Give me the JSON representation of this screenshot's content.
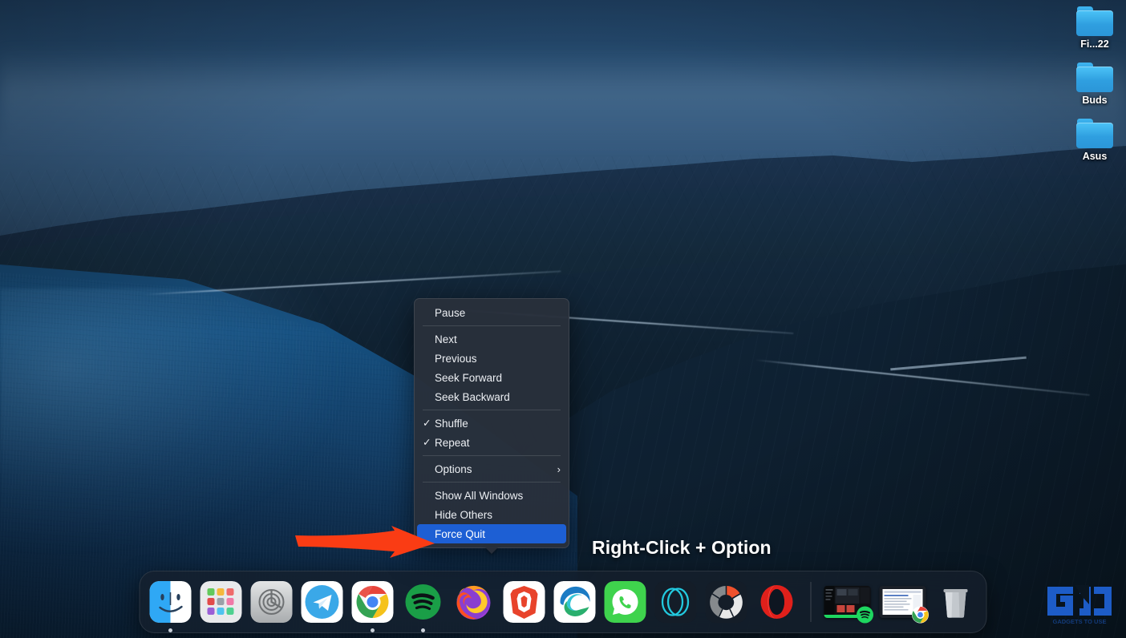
{
  "desktop": {
    "icons": [
      {
        "name": "folder-icon",
        "label": "Fi...22"
      },
      {
        "name": "folder-icon",
        "label": "Buds"
      },
      {
        "name": "folder-icon",
        "label": "Asus"
      }
    ]
  },
  "context_menu": {
    "groups": [
      {
        "items": [
          {
            "label": "Pause",
            "checked": false,
            "submenu": false,
            "highlighted": false
          }
        ]
      },
      {
        "items": [
          {
            "label": "Next",
            "checked": false,
            "submenu": false,
            "highlighted": false
          },
          {
            "label": "Previous",
            "checked": false,
            "submenu": false,
            "highlighted": false
          },
          {
            "label": "Seek Forward",
            "checked": false,
            "submenu": false,
            "highlighted": false
          },
          {
            "label": "Seek Backward",
            "checked": false,
            "submenu": false,
            "highlighted": false
          }
        ]
      },
      {
        "items": [
          {
            "label": "Shuffle",
            "checked": true,
            "submenu": false,
            "highlighted": false
          },
          {
            "label": "Repeat",
            "checked": true,
            "submenu": false,
            "highlighted": false
          }
        ]
      },
      {
        "items": [
          {
            "label": "Options",
            "checked": false,
            "submenu": true,
            "highlighted": false
          }
        ]
      },
      {
        "items": [
          {
            "label": "Show All Windows",
            "checked": false,
            "submenu": false,
            "highlighted": false
          },
          {
            "label": "Hide Others",
            "checked": false,
            "submenu": false,
            "highlighted": false
          },
          {
            "label": "Force Quit",
            "checked": false,
            "submenu": false,
            "highlighted": true
          }
        ]
      }
    ],
    "check_glyph": "✓",
    "submenu_glyph": "›",
    "highlight_color": "#1d5fd4"
  },
  "annotation": {
    "callout_text": "Right-Click + Option",
    "arrow_color": "#FA3C14",
    "arrow_name": "red-arrow-pointer"
  },
  "dock": {
    "apps": [
      {
        "name": "finder-icon",
        "label": "Finder",
        "running": true
      },
      {
        "name": "launchpad-icon",
        "label": "Launchpad",
        "running": false
      },
      {
        "name": "system-preferences-icon",
        "label": "System Preferences",
        "running": false
      },
      {
        "name": "telegram-icon",
        "label": "Telegram",
        "running": false
      },
      {
        "name": "chrome-icon",
        "label": "Google Chrome",
        "running": true
      },
      {
        "name": "spotify-icon",
        "label": "Spotify",
        "running": true
      },
      {
        "name": "firefox-icon",
        "label": "Firefox",
        "running": false
      },
      {
        "name": "brave-icon",
        "label": "Brave",
        "running": false
      },
      {
        "name": "edge-icon",
        "label": "Microsoft Edge",
        "running": false
      },
      {
        "name": "whatsapp-icon",
        "label": "WhatsApp",
        "running": false
      },
      {
        "name": "orion-icon",
        "label": "Orion",
        "running": false
      },
      {
        "name": "vivaldi-icon",
        "label": "Vivaldi",
        "running": false
      },
      {
        "name": "opera-icon",
        "label": "Opera",
        "running": false
      }
    ],
    "minimized": [
      {
        "name": "minimized-window-spotify",
        "badge": "spotify-badge",
        "label": "Spotify window"
      },
      {
        "name": "minimized-window-chrome",
        "badge": "chrome-badge",
        "label": "Chrome window"
      }
    ],
    "trash": {
      "name": "trash-icon",
      "label": "Trash"
    }
  },
  "watermark": {
    "text": "GADGETS TO USE",
    "color": "#1f63d6"
  }
}
